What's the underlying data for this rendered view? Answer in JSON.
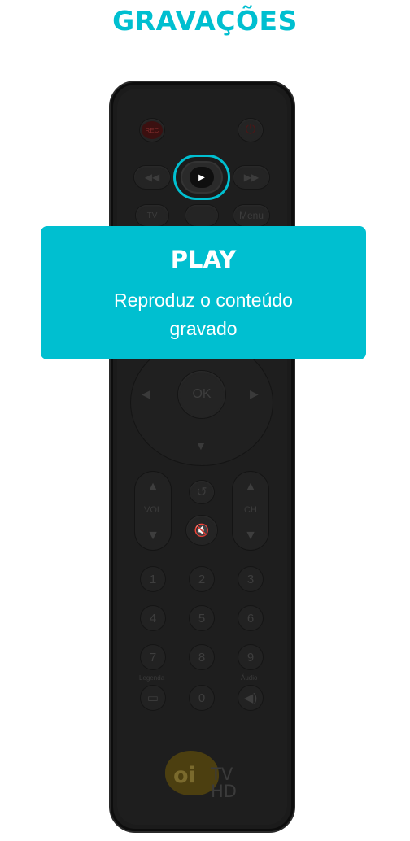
{
  "page": {
    "title": "GRAVAÇÕES"
  },
  "tooltip": {
    "title": "PLAY",
    "description_line1": "Reproduz o conteúdo",
    "description_line2": "gravado"
  },
  "remote": {
    "rec_label": "REC",
    "power_icon": "⏻",
    "rewind_icon": "◀◀",
    "play_icon": "▶",
    "fast_forward_icon": "▶▶",
    "tv_label": "TV",
    "menu_label": "Menu",
    "ok_label": "OK",
    "left_arrow": "◀",
    "right_arrow": "▶",
    "down_arrow": "▼",
    "up_arrow": "▲",
    "vol_label": "VOL",
    "ch_label": "CH",
    "back_icon": "↺",
    "mute_icon": "🔇",
    "keys": [
      "1",
      "2",
      "3",
      "4",
      "5",
      "6",
      "7",
      "8",
      "9",
      "0"
    ],
    "legenda_label": "Legenda",
    "audio_label": "Áudio",
    "subtitle_icon": "▭",
    "audio_icon": "◀)",
    "brand_oi": "oi",
    "brand_tv": "TV",
    "brand_hd": "HD"
  },
  "colors": {
    "accent": "#00bfd0",
    "remote_body": "#1b1b1b"
  }
}
